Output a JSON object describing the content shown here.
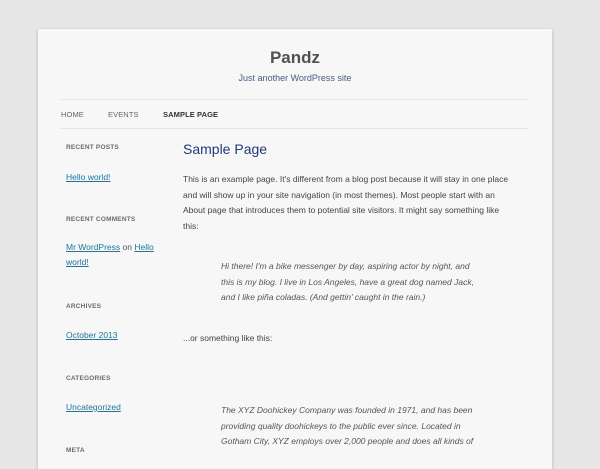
{
  "site": {
    "title": "Pandz",
    "description": "Just another WordPress site"
  },
  "nav": {
    "items": [
      {
        "label": "HOME"
      },
      {
        "label": "EVENTS"
      },
      {
        "label": "SAMPLE PAGE"
      }
    ],
    "current": "SAMPLE PAGE"
  },
  "sidebar": {
    "recent_posts": {
      "title": "RECENT POSTS",
      "links": [
        "Hello world!"
      ]
    },
    "recent_comments": {
      "title": "RECENT COMMENTS",
      "author": "Mr WordPress",
      "on": "on",
      "post_line1": "Hello",
      "post_line2": "world!"
    },
    "archives": {
      "title": "ARCHIVES",
      "links": [
        "October 2013"
      ]
    },
    "categories": {
      "title": "CATEGORIES",
      "links": [
        "Uncategorized"
      ]
    },
    "meta": {
      "title": "META"
    }
  },
  "content": {
    "title": "Sample Page",
    "intro_lines": [
      "This is an example page. It's different from a blog post because it will stay in one place",
      "and will show up in your site navigation (in most themes). Most people start with an",
      "About page that introduces them to potential site visitors. It might say something like",
      "this:"
    ],
    "quote1_lines": [
      "Hi there! I'm a bike messenger by day, aspiring actor by night, and",
      "this is my blog. I live in Los Angeles, have a great dog named Jack,",
      "and I like piña coladas. (And gettin' caught in the rain.)"
    ],
    "middle": "...or something like this:",
    "quote2_lines": [
      "The XYZ Doohickey Company was founded in 1971, and has been",
      "providing quality doohickeys to the public ever since. Located in",
      "Gotham City, XYZ employs over 2,000 people and does all kinds of"
    ]
  }
}
